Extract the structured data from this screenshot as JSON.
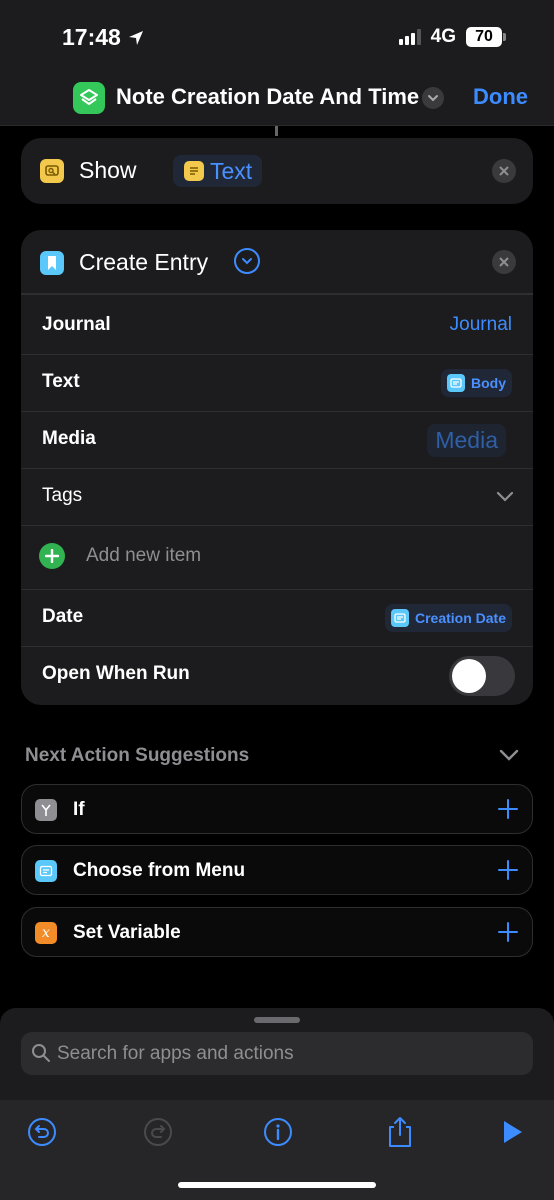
{
  "status": {
    "time": "17:48",
    "network": "4G",
    "battery": "70"
  },
  "nav": {
    "title": "Note Creation Date And Time",
    "done_label": "Done",
    "app_icon": "layers-icon"
  },
  "show_action": {
    "label": "Show",
    "token": "Text"
  },
  "entry_action": {
    "title": "Create Entry",
    "rows": {
      "journal": {
        "label": "Journal",
        "value": "Journal"
      },
      "text": {
        "label": "Text",
        "value": "Body"
      },
      "media": {
        "label": "Media",
        "value": "Media"
      },
      "tags": {
        "label": "Tags"
      },
      "add_item": {
        "label": "Add new item"
      },
      "date": {
        "label": "Date",
        "value": "Creation Date"
      },
      "open_when_run": {
        "label": "Open When Run",
        "enabled": false
      }
    }
  },
  "suggestions": {
    "title": "Next Action Suggestions",
    "items": [
      {
        "label": "If",
        "icon": "branch-icon",
        "color": "#8e8e93"
      },
      {
        "label": "Choose from Menu",
        "icon": "menu-icon",
        "color": "#5ac8fa"
      },
      {
        "label": "Set Variable",
        "icon": "variable-icon",
        "color": "#f28c28"
      }
    ]
  },
  "search": {
    "placeholder": "Search for apps and actions"
  },
  "colors": {
    "accent": "#3d8cff",
    "show_icon": "#f2c94c",
    "entry_icon": "#5ac8fa",
    "app_icon": "#34c759"
  }
}
